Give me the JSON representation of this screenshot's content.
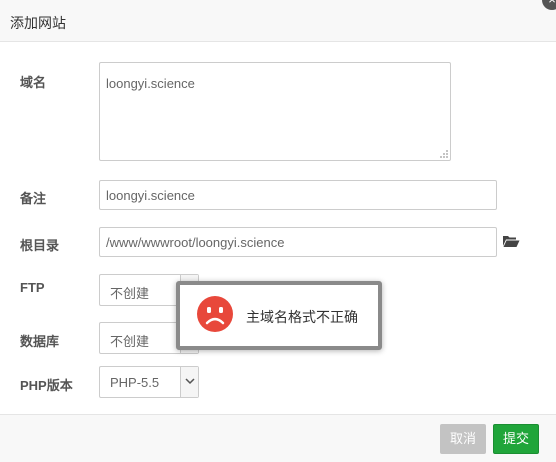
{
  "dialog": {
    "title": "添加网站",
    "close_glyph": "×"
  },
  "form": {
    "domain": {
      "label": "域名",
      "value": "loongyi.science"
    },
    "remark": {
      "label": "备注",
      "value": "loongyi.science"
    },
    "root_dir": {
      "label": "根目录",
      "value": "/www/wwwroot/loongyi.science",
      "icon": "folder-open-icon"
    },
    "ftp": {
      "label": "FTP",
      "selected": "不创建"
    },
    "database": {
      "label": "数据库",
      "selected": "不创建"
    },
    "php_version": {
      "label": "PHP版本",
      "selected": "PHP-5.5"
    }
  },
  "footer": {
    "cancel_label": "取消",
    "submit_label": "提交"
  },
  "toast": {
    "message": "主域名格式不正确",
    "icon": "sad-face-icon",
    "icon_color": "#e8483b"
  },
  "colors": {
    "submit": "#20a53a",
    "cancel": "#c3c3c3"
  }
}
